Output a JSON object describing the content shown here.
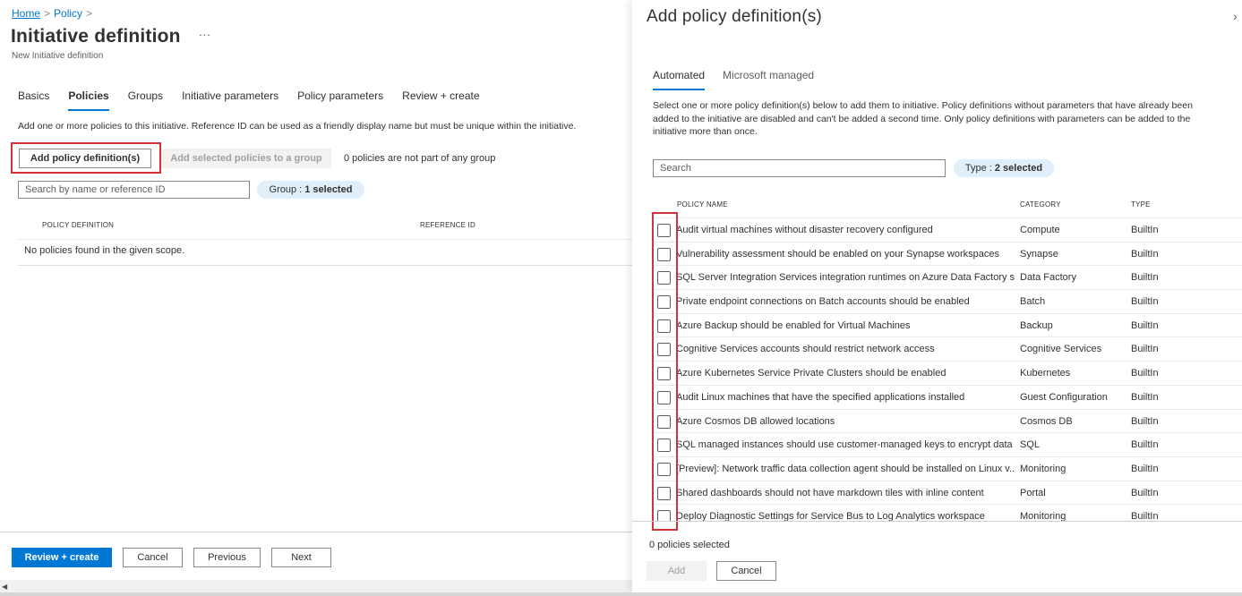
{
  "breadcrumb": [
    {
      "label": "Home"
    },
    {
      "label": "Policy"
    }
  ],
  "breadcrumb_separator": ">",
  "page": {
    "title": "Initiative definition",
    "more_label": "···",
    "subtitle": "New Initiative definition"
  },
  "tabs": [
    {
      "label": "Basics",
      "active": false
    },
    {
      "label": "Policies",
      "active": true
    },
    {
      "label": "Groups",
      "active": false
    },
    {
      "label": "Initiative parameters",
      "active": false
    },
    {
      "label": "Policy parameters",
      "active": false
    },
    {
      "label": "Review + create",
      "active": false
    }
  ],
  "policies": {
    "description": "Add one or more policies to this initiative. Reference ID can be used as a friendly display name but must be unique within the initiative.",
    "add_policy_label": "Add policy definition(s)",
    "add_to_group_label": "Add selected policies to a group",
    "not_in_group_text": "0 policies are not part of any group",
    "search_placeholder": "Search by name or reference ID",
    "group_filter": {
      "label": "Group :",
      "value": "1 selected"
    },
    "columns": [
      "POLICY DEFINITION",
      "REFERENCE ID"
    ],
    "empty_text": "No policies found in the given scope."
  },
  "footer": {
    "review_create": "Review + create",
    "cancel": "Cancel",
    "previous": "Previous",
    "next": "Next"
  },
  "blade": {
    "title": "Add policy definition(s)",
    "close_icon": "chevron-right-icon",
    "tabs": [
      {
        "label": "Automated",
        "active": true
      },
      {
        "label": "Microsoft managed",
        "active": false
      }
    ],
    "description": "Select one or more policy definition(s) below to add them to initiative. Policy definitions without parameters that have already been added to the initiative are disabled and can't be added a second time. Only policy definitions with parameters can be added to the initiative more than once.",
    "search_placeholder": "Search",
    "type_filter": {
      "label": "Type :",
      "value": "2 selected"
    },
    "columns": {
      "name": "POLICY NAME",
      "category": "CATEGORY",
      "type": "TYPE"
    },
    "rows": [
      {
        "name": "Audit virtual machines without disaster recovery configured",
        "category": "Compute",
        "type": "BuiltIn",
        "checked": false
      },
      {
        "name": "Vulnerability assessment should be enabled on your Synapse workspaces",
        "category": "Synapse",
        "type": "BuiltIn",
        "checked": false
      },
      {
        "name": "SQL Server Integration Services integration runtimes on Azure Data Factory s...",
        "category": "Data Factory",
        "type": "BuiltIn",
        "checked": false
      },
      {
        "name": "Private endpoint connections on Batch accounts should be enabled",
        "category": "Batch",
        "type": "BuiltIn",
        "checked": false
      },
      {
        "name": "Azure Backup should be enabled for Virtual Machines",
        "category": "Backup",
        "type": "BuiltIn",
        "checked": false
      },
      {
        "name": "Cognitive Services accounts should restrict network access",
        "category": "Cognitive Services",
        "type": "BuiltIn",
        "checked": false
      },
      {
        "name": "Azure Kubernetes Service Private Clusters should be enabled",
        "category": "Kubernetes",
        "type": "BuiltIn",
        "checked": false
      },
      {
        "name": "Audit Linux machines that have the specified applications installed",
        "category": "Guest Configuration",
        "type": "BuiltIn",
        "checked": false
      },
      {
        "name": "Azure Cosmos DB allowed locations",
        "category": "Cosmos DB",
        "type": "BuiltIn",
        "checked": false
      },
      {
        "name": "SQL managed instances should use customer-managed keys to encrypt data ...",
        "category": "SQL",
        "type": "BuiltIn",
        "checked": false
      },
      {
        "name": "[Preview]: Network traffic data collection agent should be installed on Linux v...",
        "category": "Monitoring",
        "type": "BuiltIn",
        "checked": false
      },
      {
        "name": "Shared dashboards should not have markdown tiles with inline content",
        "category": "Portal",
        "type": "BuiltIn",
        "checked": false
      },
      {
        "name": "Deploy Diagnostic Settings for Service Bus to Log Analytics workspace",
        "category": "Monitoring",
        "type": "BuiltIn",
        "checked": false
      }
    ],
    "selected_count": "0 policies selected",
    "add_label": "Add",
    "cancel_label": "Cancel"
  },
  "colors": {
    "accent": "#0078d4",
    "highlight_box": "#d13438",
    "pill_bg": "#e1effa"
  }
}
